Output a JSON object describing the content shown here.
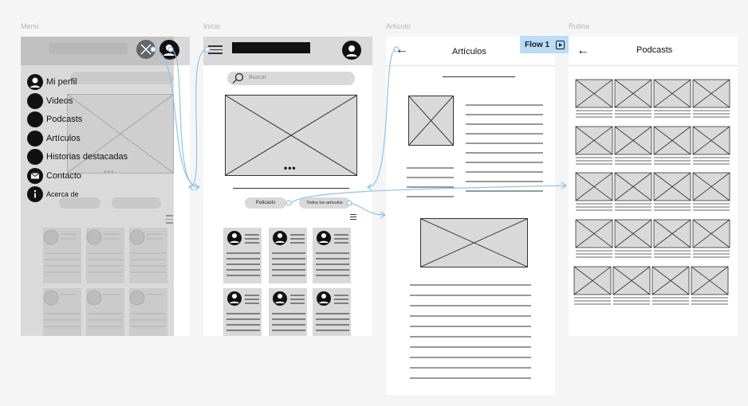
{
  "frames": {
    "menu": {
      "label": "Menú"
    },
    "inicio": {
      "label": "Inicio"
    },
    "articulo": {
      "label": "Artículo"
    },
    "rutina": {
      "label": "Rutina"
    }
  },
  "menu": {
    "items": [
      {
        "label": "Mi perfil",
        "icon": "user-icon"
      },
      {
        "label": "Videos",
        "icon": "circle-icon"
      },
      {
        "label": "Podcasts",
        "icon": "circle-icon"
      },
      {
        "label": "Artículos",
        "icon": "circle-icon"
      },
      {
        "label": "Historias destacadas",
        "icon": "circle-icon"
      },
      {
        "label": "Contacto",
        "icon": "mail-icon"
      },
      {
        "label": "Acerca de",
        "icon": "info-icon"
      }
    ],
    "close_icon": "close-icon"
  },
  "inicio": {
    "search_placeholder": "Buscar",
    "pill_podcasts": "Podcasts",
    "pill_todos": "Todos los artículos"
  },
  "articulo": {
    "title": "Artículos",
    "back_arrow": "←"
  },
  "rutina": {
    "title": "Podcasts",
    "back_arrow": "←"
  },
  "flow": {
    "label": "Flow 1"
  },
  "colors": {
    "placeholder_fill": "#d9d9d9",
    "connector": "#8cc4f0",
    "flow_tag": "#b9dcf7"
  }
}
